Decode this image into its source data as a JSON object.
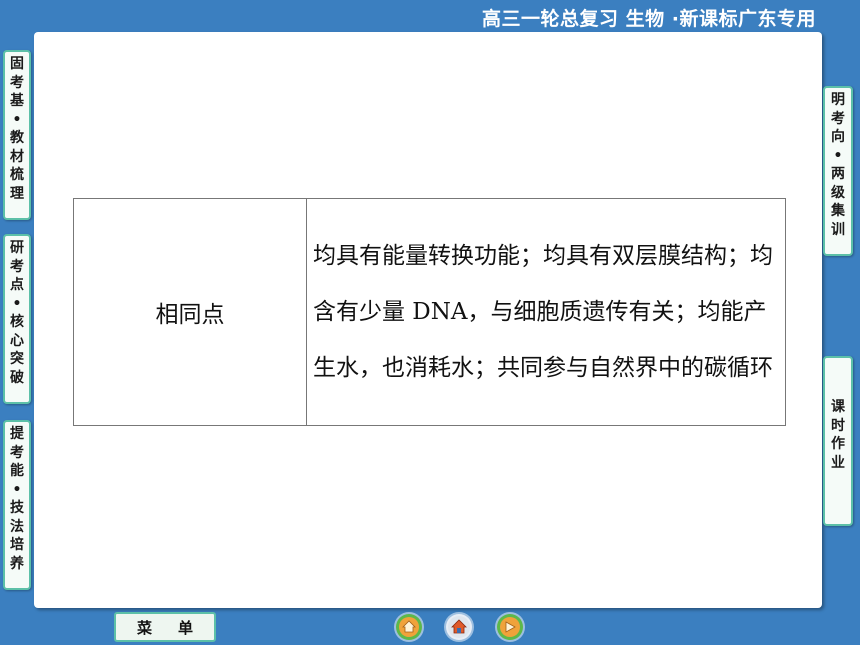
{
  "header": {
    "title": "高三一轮总复习 生物 ·新课标广东专用"
  },
  "left_nav": [
    {
      "chars": [
        "固",
        "考",
        "基",
        "•",
        "教",
        "材",
        "梳",
        "理"
      ]
    },
    {
      "chars": [
        "研",
        "考",
        "点",
        "•",
        "核",
        "心",
        "突",
        "破"
      ]
    },
    {
      "chars": [
        "提",
        "考",
        "能",
        "•",
        "技",
        "法",
        "培",
        "养"
      ]
    }
  ],
  "right_nav": [
    {
      "chars": [
        "明",
        "考",
        "向",
        "•",
        "两",
        "级",
        "集",
        "训"
      ]
    },
    {
      "chars": [
        "课",
        "时",
        "作",
        "业"
      ]
    }
  ],
  "table": {
    "label": "相同点",
    "content": "均具有能量转换功能；均具有双层膜结构；均含有少量 DNA，与细胞质遗传有关；均能产生水，也消耗水；共同参与自然界中的碳循环"
  },
  "bottom": {
    "menu_label_1": "菜",
    "menu_label_2": "单",
    "icons": [
      "home-icon",
      "house-return-icon",
      "next-icon"
    ]
  },
  "colors": {
    "background": "#3b7fc0",
    "button_border": "#5cc0a8",
    "nav_orange": "#f0a23a",
    "nav_green": "#5db84a"
  }
}
